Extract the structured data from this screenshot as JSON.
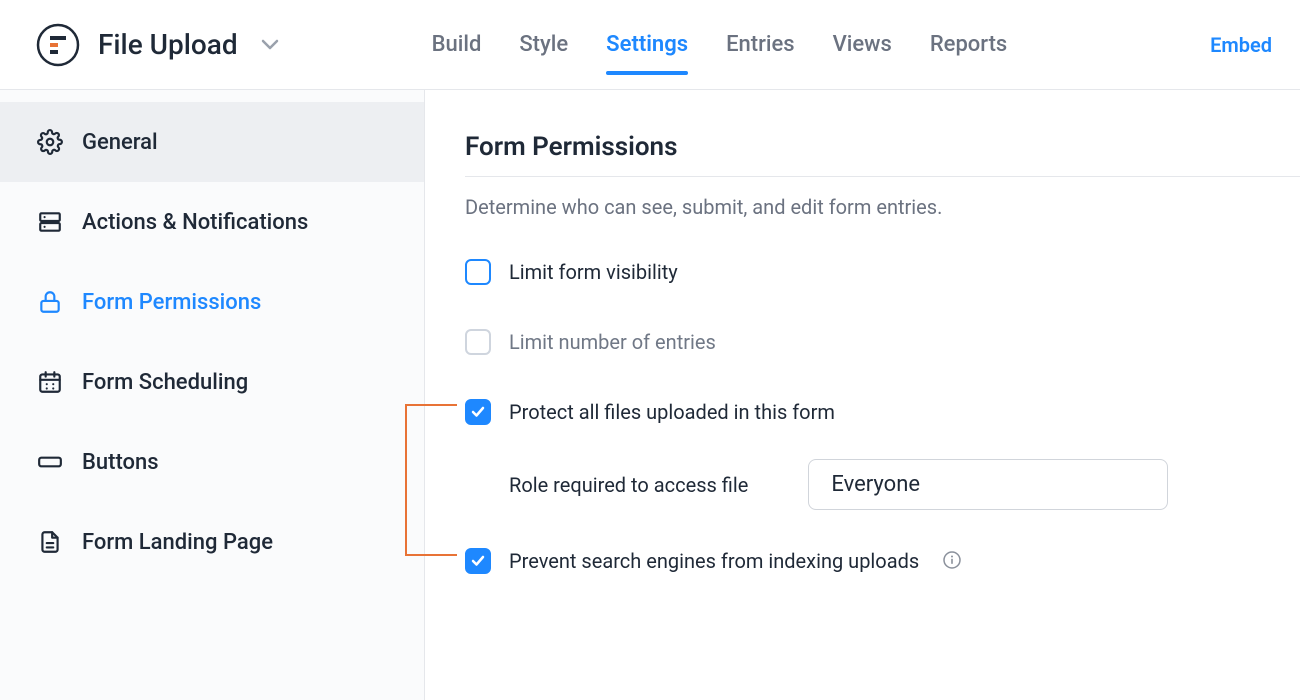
{
  "header": {
    "form_title": "File Upload",
    "tabs": [
      "Build",
      "Style",
      "Settings",
      "Entries",
      "Views",
      "Reports"
    ],
    "active_tab_index": 2,
    "embed_label": "Embed"
  },
  "sidebar": {
    "items": [
      {
        "icon": "gear-icon",
        "label": "General",
        "selected": true
      },
      {
        "icon": "stack-icon",
        "label": "Actions & Notifications"
      },
      {
        "icon": "lock-icon",
        "label": "Form Permissions",
        "highlight": true
      },
      {
        "icon": "calendar-icon",
        "label": "Form Scheduling"
      },
      {
        "icon": "button-icon",
        "label": "Buttons"
      },
      {
        "icon": "page-icon",
        "label": "Form Landing Page"
      }
    ]
  },
  "panel": {
    "title": "Form Permissions",
    "description": "Determine who can see, submit, and edit form entries.",
    "options": {
      "limit_visibility": {
        "label": "Limit form visibility",
        "checked": false,
        "active_border": true
      },
      "limit_entries": {
        "label": "Limit number of entries",
        "checked": false
      },
      "protect_files": {
        "label": "Protect all files uploaded in this form",
        "checked": true
      },
      "role_label": "Role required to access file",
      "role_value": "Everyone",
      "prevent_index": {
        "label": "Prevent search engines from indexing uploads",
        "checked": true
      }
    }
  }
}
